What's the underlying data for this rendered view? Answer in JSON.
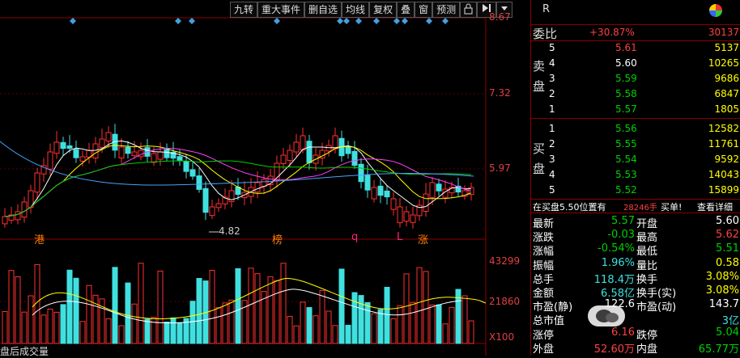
{
  "toolbar": {
    "buttons": [
      "九转",
      "重大事件",
      "删自选",
      "均线",
      "复权",
      "叠",
      "窗",
      "预测"
    ],
    "lock_icon": "lock-icon",
    "skip_icon": "skip-end-icon",
    "menu_icon": "dropdown-icon"
  },
  "price_axis": {
    "top": "8.67",
    "mid": "7.32",
    "low": "5.97",
    "min_marker": "4.82"
  },
  "volume_axis": {
    "top": "43299",
    "mid": "21860",
    "unit": "X100"
  },
  "bottom_label": "盘后成交量",
  "event_markers": [
    "港",
    "榜",
    "q",
    "L",
    "涨"
  ],
  "panel": {
    "header_letter": "R",
    "weibi": {
      "label": "委比",
      "pct": "+30.87%",
      "diff": "30137"
    },
    "sell_label": [
      "卖",
      "盘"
    ],
    "buy_label": [
      "买",
      "盘"
    ],
    "sell": [
      {
        "lvl": "5",
        "price": "5.61",
        "vol": "5137",
        "color": "red"
      },
      {
        "lvl": "4",
        "price": "5.60",
        "vol": "10265",
        "color": "white"
      },
      {
        "lvl": "3",
        "price": "5.59",
        "vol": "9686",
        "color": "green"
      },
      {
        "lvl": "2",
        "price": "5.58",
        "vol": "6847",
        "color": "green"
      },
      {
        "lvl": "1",
        "price": "5.57",
        "vol": "1805",
        "color": "green"
      }
    ],
    "buy": [
      {
        "lvl": "1",
        "price": "5.56",
        "vol": "12582",
        "color": "green"
      },
      {
        "lvl": "2",
        "price": "5.55",
        "vol": "11761",
        "color": "green"
      },
      {
        "lvl": "3",
        "price": "5.54",
        "vol": "9592",
        "color": "green"
      },
      {
        "lvl": "4",
        "price": "5.53",
        "vol": "14043",
        "color": "green"
      },
      {
        "lvl": "5",
        "price": "5.52",
        "vol": "15899",
        "color": "green"
      }
    ],
    "notice": {
      "text1": "在买盘5.50位置有",
      "qty": "28246手",
      "text2": "买单!",
      "link": "查看详细"
    },
    "stats": [
      {
        "l1": "最新",
        "v1": "5.57",
        "c1": "green",
        "l2": "开盘",
        "v2": "5.60",
        "c2": "white"
      },
      {
        "l1": "涨跌",
        "v1": "-0.03",
        "c1": "green",
        "l2": "最高",
        "v2": "5.62",
        "c2": "red"
      },
      {
        "l1": "涨幅",
        "v1": "-0.54%",
        "c1": "green",
        "l2": "最低",
        "v2": "5.51",
        "c2": "green"
      },
      {
        "l1": "振幅",
        "v1": "1.96%",
        "c1": "cyan",
        "l2": "量比",
        "v2": "0.58",
        "c2": "yellow"
      },
      {
        "l1": "总手",
        "v1": "118.4万",
        "c1": "cyan",
        "l2": "换手",
        "v2": "3.08%",
        "c2": "yellow"
      },
      {
        "l1": "金额",
        "v1": "6.58亿",
        "c1": "cyan",
        "l2": "换手(实)",
        "v2": "3.08%",
        "c2": "yellow"
      },
      {
        "l1": "市盈(静)",
        "v1": "122.6",
        "c1": "white",
        "l2": "市盈(动)",
        "v2": "143.7",
        "c2": "white"
      },
      {
        "l1": "总市值",
        "v1": "",
        "c1": "white",
        "l2": "",
        "v2": "3亿",
        "c2": "cyan"
      },
      {
        "l1": "涨停",
        "v1": "6.16",
        "c1": "red",
        "l2": "跌停",
        "v2": "5.04",
        "c2": "green"
      },
      {
        "l1": "外盘",
        "v1": "52.60万",
        "c1": "red",
        "l2": "内盘",
        "v2": "65.77万",
        "c2": "green"
      }
    ]
  }
}
